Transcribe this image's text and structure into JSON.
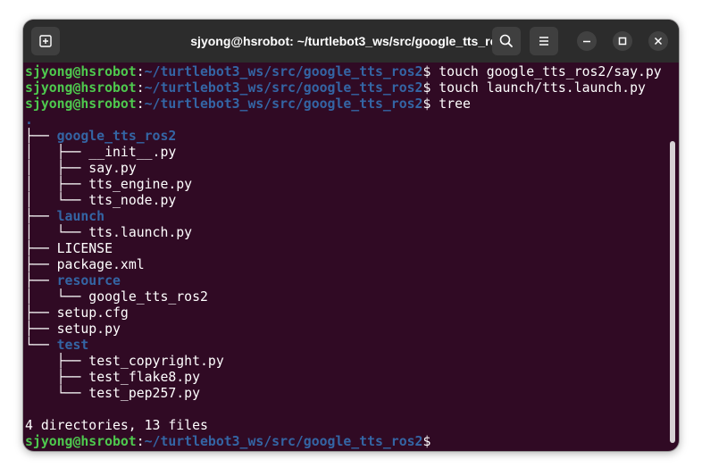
{
  "window": {
    "title": "sjyong@hsrobot: ~/turtlebot3_ws/src/google_tts_ros2"
  },
  "toolbar": {
    "new_tab_icon": "new-tab-icon",
    "search_icon": "search-icon",
    "menu_icon": "hamburger-menu-icon",
    "minimize_icon": "minimize-icon",
    "maximize_icon": "maximize-icon",
    "close_icon": "close-icon"
  },
  "prompt": {
    "user": "sjyong@hsrobot",
    "colon": ":",
    "path": "~/turtlebot3_ws/src/google_tts_ros2",
    "dollar": "$"
  },
  "commands": [
    " touch google_tts_ros2/say.py",
    " touch launch/tts.launch.py",
    " tree"
  ],
  "tree": [
    {
      "prefix": "",
      "name": ".",
      "dir": true
    },
    {
      "prefix": "├── ",
      "name": "google_tts_ros2",
      "dir": true
    },
    {
      "prefix": "│   ├── ",
      "name": "__init__.py",
      "dir": false
    },
    {
      "prefix": "│   ├── ",
      "name": "say.py",
      "dir": false
    },
    {
      "prefix": "│   ├── ",
      "name": "tts_engine.py",
      "dir": false
    },
    {
      "prefix": "│   └── ",
      "name": "tts_node.py",
      "dir": false
    },
    {
      "prefix": "├── ",
      "name": "launch",
      "dir": true
    },
    {
      "prefix": "│   └── ",
      "name": "tts.launch.py",
      "dir": false
    },
    {
      "prefix": "├── ",
      "name": "LICENSE",
      "dir": false
    },
    {
      "prefix": "├── ",
      "name": "package.xml",
      "dir": false
    },
    {
      "prefix": "├── ",
      "name": "resource",
      "dir": true
    },
    {
      "prefix": "│   └── ",
      "name": "google_tts_ros2",
      "dir": false
    },
    {
      "prefix": "├── ",
      "name": "setup.cfg",
      "dir": false
    },
    {
      "prefix": "├── ",
      "name": "setup.py",
      "dir": false
    },
    {
      "prefix": "└── ",
      "name": "test",
      "dir": true
    },
    {
      "prefix": "    ├── ",
      "name": "test_copyright.py",
      "dir": false
    },
    {
      "prefix": "    ├── ",
      "name": "test_flake8.py",
      "dir": false
    },
    {
      "prefix": "    └── ",
      "name": "test_pep257.py",
      "dir": false
    }
  ],
  "summary": "4 directories, 13 files",
  "colors": {
    "background": "#300a24",
    "titlebar": "#2c2c2c",
    "user": "#4ec94e",
    "path": "#3465a4",
    "text": "#ffffff"
  }
}
